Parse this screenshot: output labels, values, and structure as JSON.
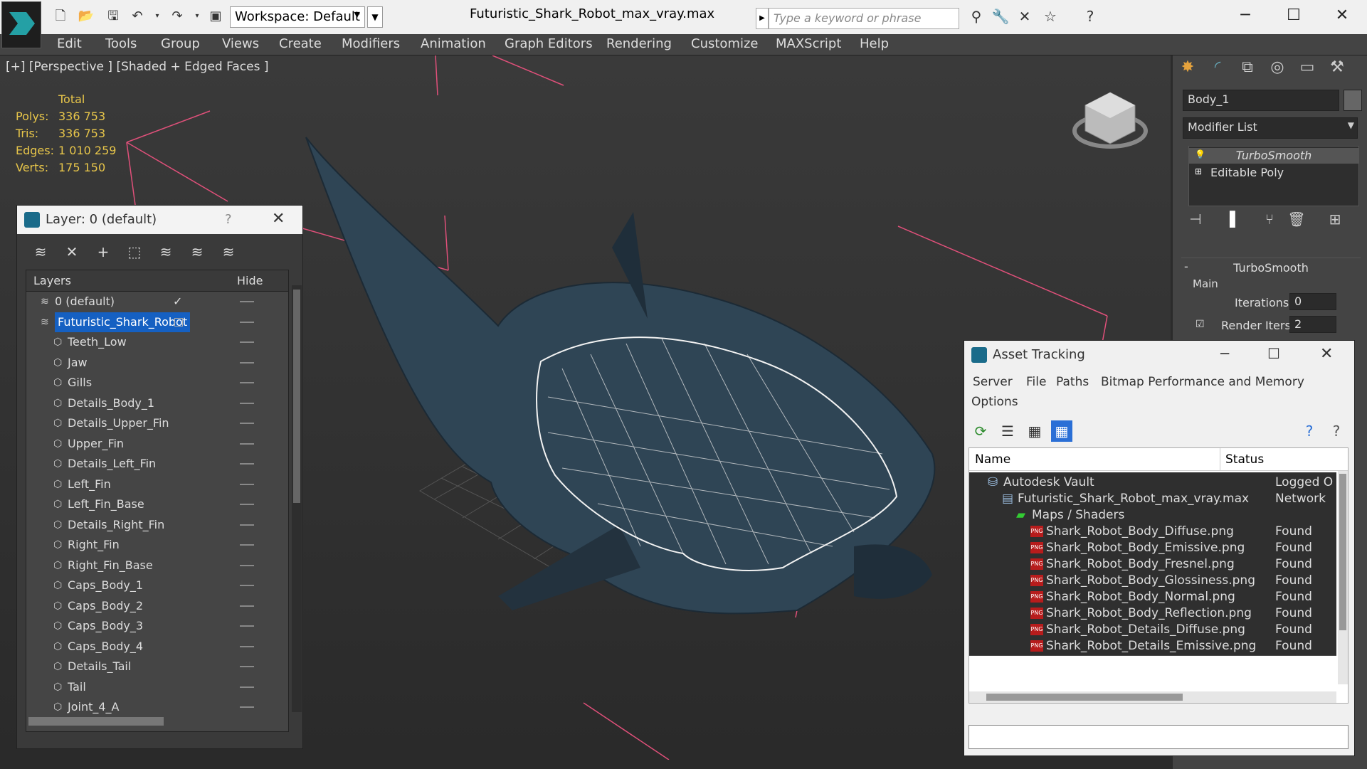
{
  "app": {
    "window_title": "Futuristic_Shark_Robot_max_vray.max",
    "workspace_label": "Workspace: Default",
    "search_placeholder": "Type a keyword or phrase"
  },
  "menu": [
    "Edit",
    "Tools",
    "Group",
    "Views",
    "Create",
    "Modifiers",
    "Animation",
    "Graph Editors",
    "Rendering",
    "Customize",
    "MAXScript",
    "Help"
  ],
  "viewport": {
    "label": "[+] [Perspective ] [Shaded + Edged Faces ]",
    "stats_header": "Total",
    "stats": [
      {
        "k": "Polys:",
        "v": "336 753"
      },
      {
        "k": "Tris:",
        "v": "336 753"
      },
      {
        "k": "Edges:",
        "v": "1 010 259"
      },
      {
        "k": "Verts:",
        "v": "175 150"
      }
    ]
  },
  "layer_dialog": {
    "title": "Layer: 0 (default)",
    "help": "?",
    "col_layers": "Layers",
    "col_hide": "Hide",
    "rows": [
      {
        "name": "0 (default)",
        "indent": 0,
        "selected": false,
        "checked": true
      },
      {
        "name": "Futuristic_Shark_Robot",
        "indent": 0,
        "selected": true,
        "checked": false
      },
      {
        "name": "Teeth_Low",
        "indent": 1
      },
      {
        "name": "Jaw",
        "indent": 1
      },
      {
        "name": "Gills",
        "indent": 1
      },
      {
        "name": "Details_Body_1",
        "indent": 1
      },
      {
        "name": "Details_Upper_Fin",
        "indent": 1
      },
      {
        "name": "Upper_Fin",
        "indent": 1
      },
      {
        "name": "Details_Left_Fin",
        "indent": 1
      },
      {
        "name": "Left_Fin",
        "indent": 1
      },
      {
        "name": "Left_Fin_Base",
        "indent": 1
      },
      {
        "name": "Details_Right_Fin",
        "indent": 1
      },
      {
        "name": "Right_Fin",
        "indent": 1
      },
      {
        "name": "Right_Fin_Base",
        "indent": 1
      },
      {
        "name": "Caps_Body_1",
        "indent": 1
      },
      {
        "name": "Caps_Body_2",
        "indent": 1
      },
      {
        "name": "Caps_Body_3",
        "indent": 1
      },
      {
        "name": "Caps_Body_4",
        "indent": 1
      },
      {
        "name": "Details_Tail",
        "indent": 1
      },
      {
        "name": "Tail",
        "indent": 1
      },
      {
        "name": "Joint_4_A",
        "indent": 1
      }
    ]
  },
  "command_panel": {
    "object_name": "Body_1",
    "modifier_list": "Modifier List",
    "stack": [
      "TurboSmooth",
      "Editable Poly"
    ],
    "rollout_title": "TurboSmooth",
    "group_main": "Main",
    "iterations_label": "Iterations:",
    "iterations_value": "0",
    "render_iters_label": "Render Iters:",
    "render_iters_value": "2"
  },
  "asset_dialog": {
    "title": "Asset Tracking",
    "menu": [
      "Server",
      "File",
      "Paths",
      "Bitmap Performance and Memory",
      "Options"
    ],
    "col_name": "Name",
    "col_status": "Status",
    "rows": [
      {
        "name": "Autodesk Vault",
        "status": "Logged O",
        "indent": 1,
        "icon": "vault"
      },
      {
        "name": "Futuristic_Shark_Robot_max_vray.max",
        "status": "Network",
        "indent": 2,
        "icon": "max"
      },
      {
        "name": "Maps / Shaders",
        "status": "",
        "indent": 3,
        "icon": "maps"
      },
      {
        "name": "Shark_Robot_Body_Diffuse.png",
        "status": "Found",
        "indent": 4,
        "icon": "png"
      },
      {
        "name": "Shark_Robot_Body_Emissive.png",
        "status": "Found",
        "indent": 4,
        "icon": "png"
      },
      {
        "name": "Shark_Robot_Body_Fresnel.png",
        "status": "Found",
        "indent": 4,
        "icon": "png"
      },
      {
        "name": "Shark_Robot_Body_Glossiness.png",
        "status": "Found",
        "indent": 4,
        "icon": "png"
      },
      {
        "name": "Shark_Robot_Body_Normal.png",
        "status": "Found",
        "indent": 4,
        "icon": "png"
      },
      {
        "name": "Shark_Robot_Body_Reflection.png",
        "status": "Found",
        "indent": 4,
        "icon": "png"
      },
      {
        "name": "Shark_Robot_Details_Diffuse.png",
        "status": "Found",
        "indent": 4,
        "icon": "png"
      },
      {
        "name": "Shark_Robot_Details_Emissive.png",
        "status": "Found",
        "indent": 4,
        "icon": "png"
      }
    ]
  }
}
